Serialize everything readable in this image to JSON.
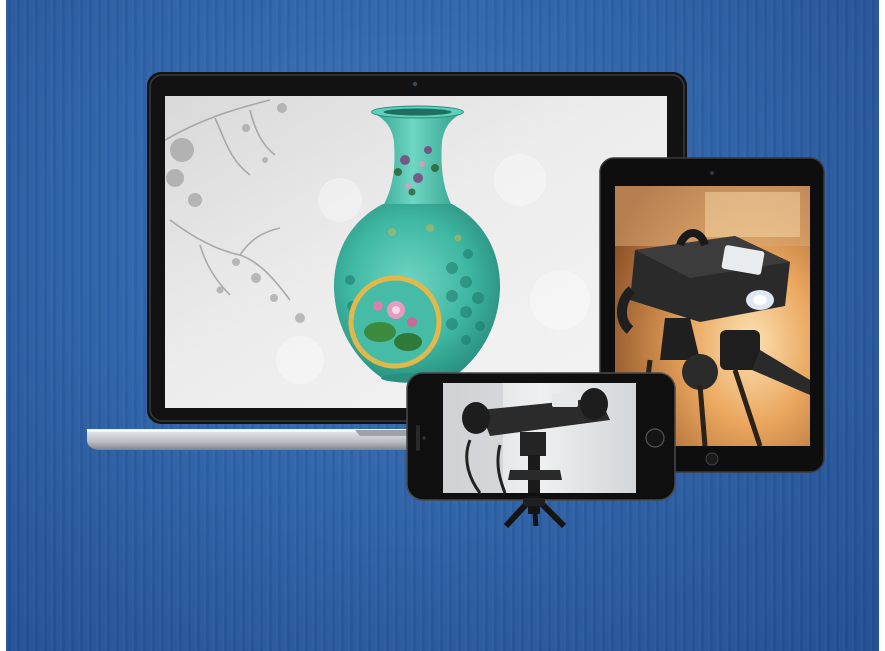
{
  "scene": {
    "background_color": "#2f63a8",
    "devices": [
      {
        "name": "laptop",
        "content": "vase-model"
      },
      {
        "name": "tablet",
        "content": "scanner-photo"
      },
      {
        "name": "phone",
        "content": "scanner-on-tripod-photo"
      }
    ],
    "colors": {
      "vase_turquoise": "#3fb8a3",
      "vase_gold_ring": "#e3b84a",
      "bezel": "#111111",
      "laptop_body": "#c9ccd1",
      "tablet_warm": "#e9a65b"
    }
  }
}
